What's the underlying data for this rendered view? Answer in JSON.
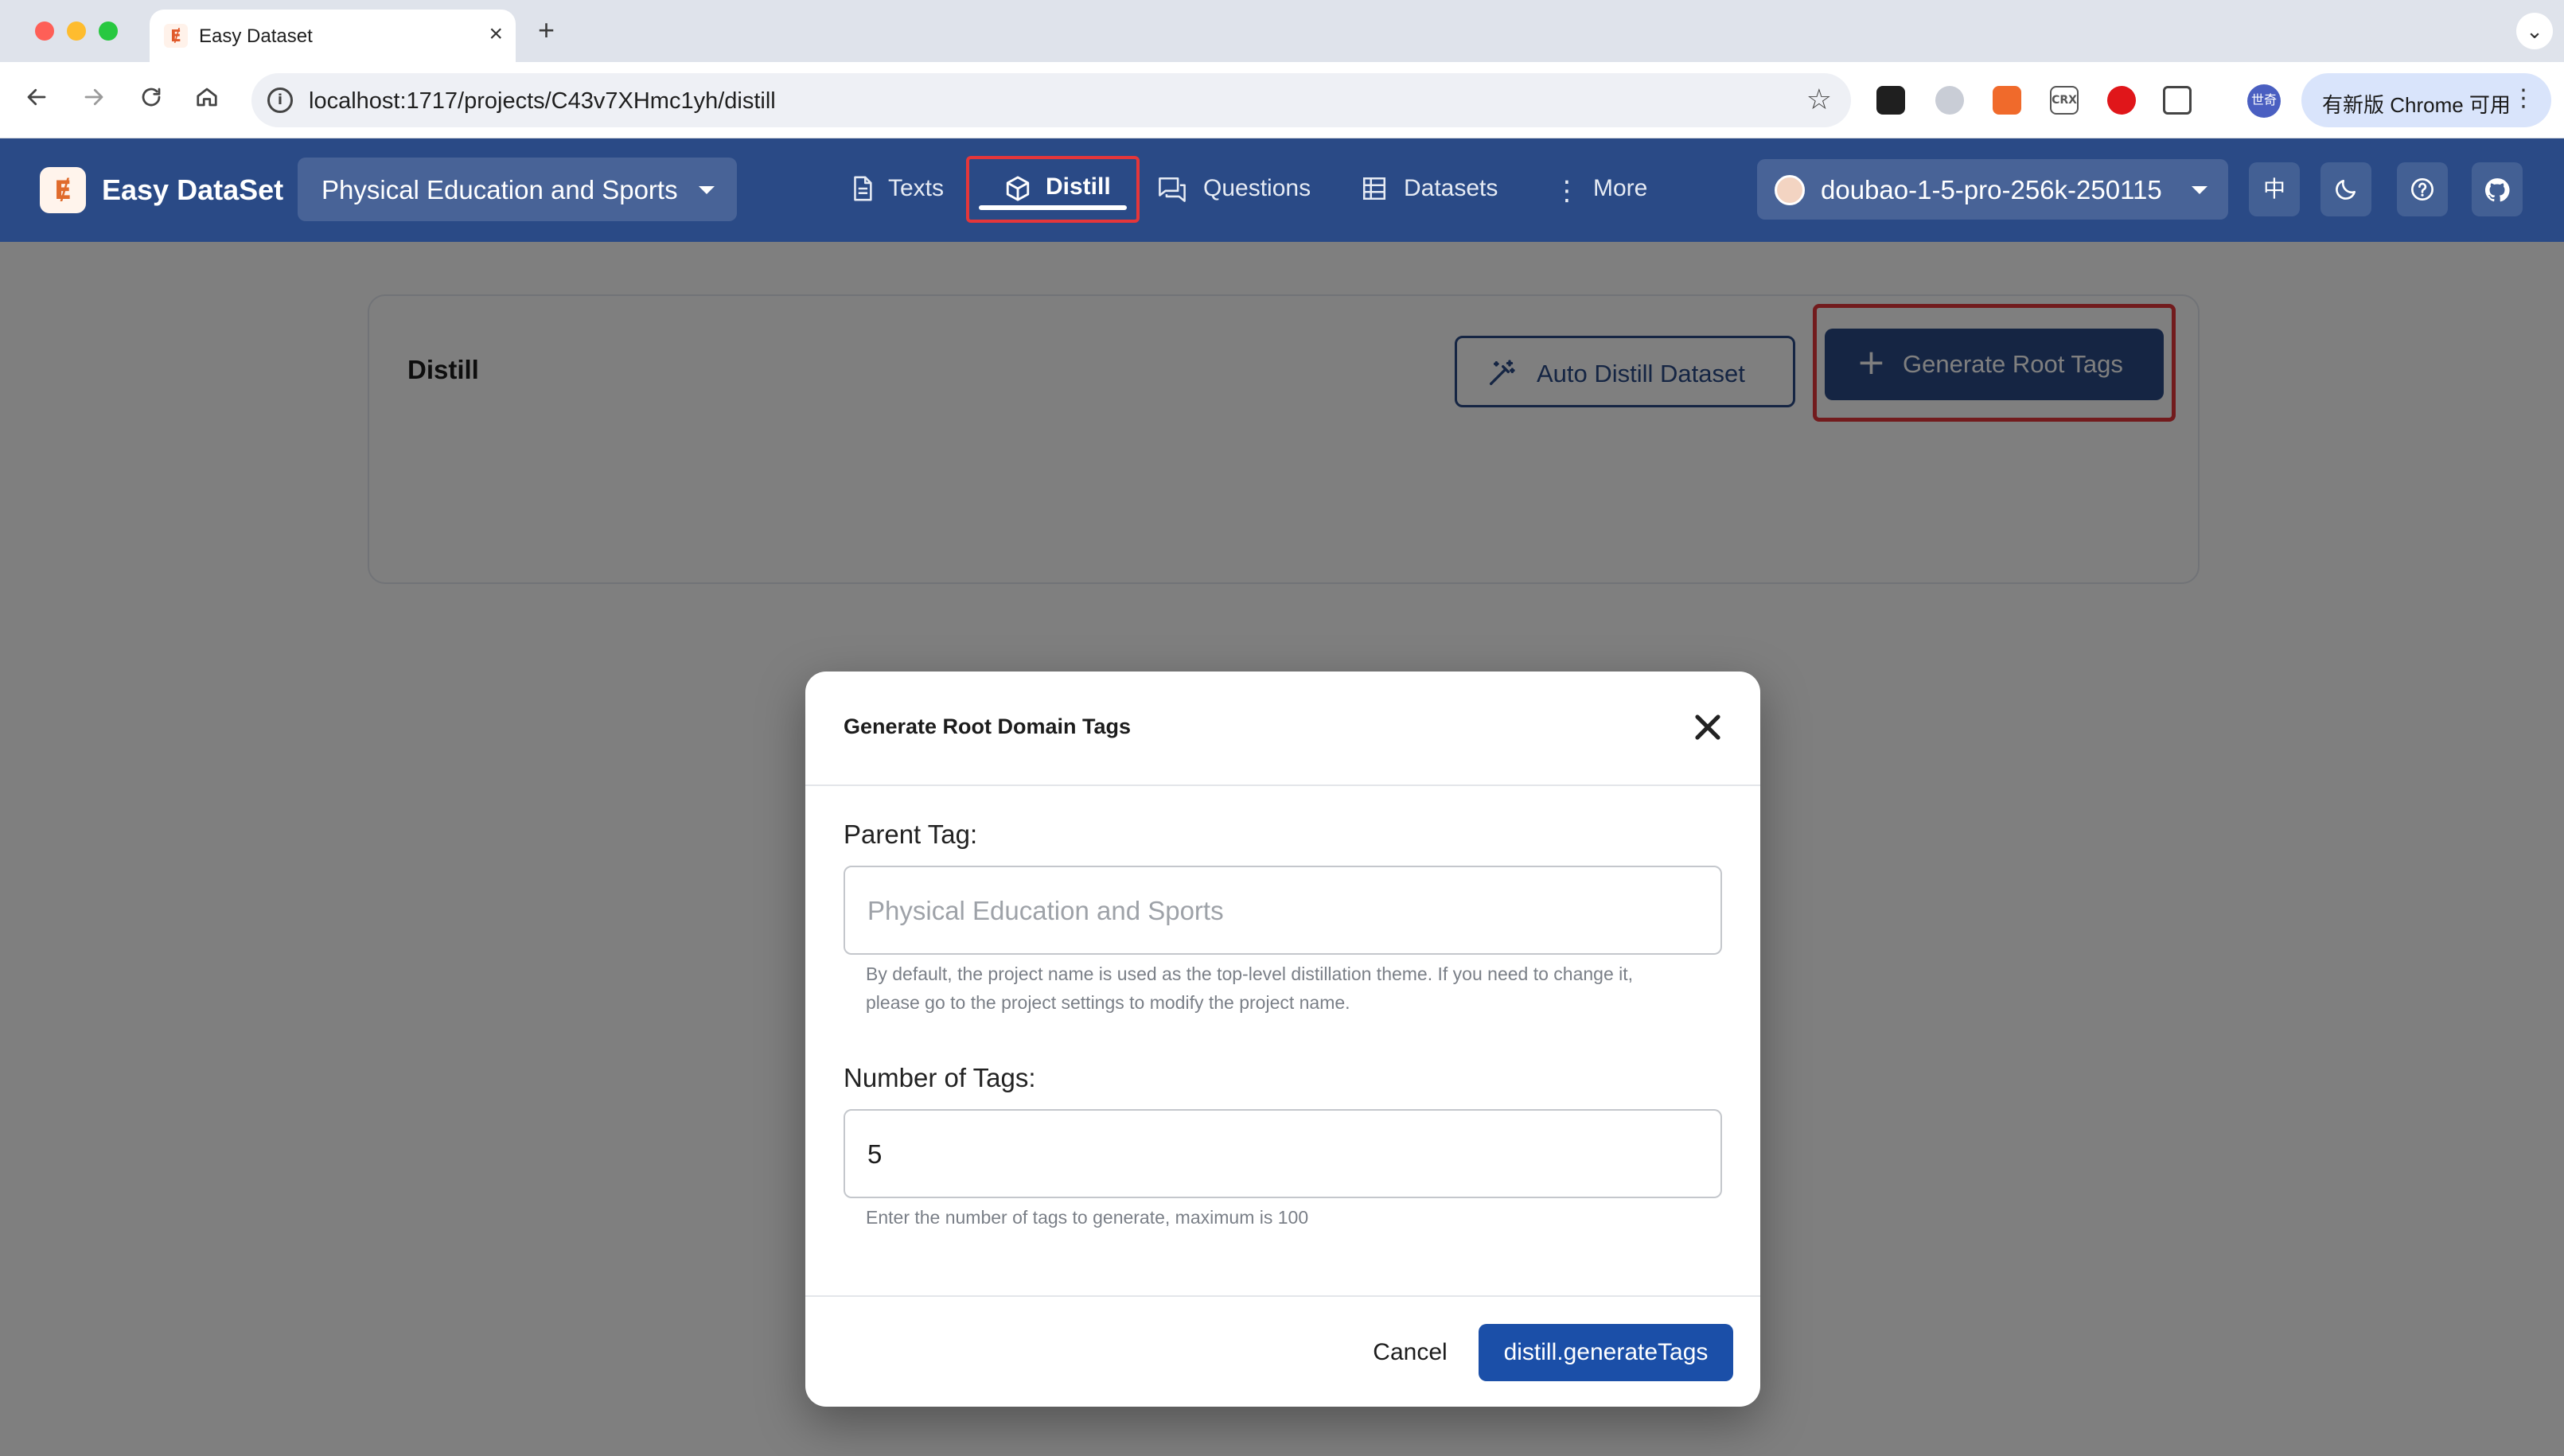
{
  "browser": {
    "tab_title": "Easy Dataset",
    "tab_favicon": "Ɇ",
    "new_tab_label": "+",
    "url": "localhost:1717/projects/C43v7XHmc1yh/distill",
    "profile_label": "世奇",
    "update_label": "有新版 Chrome 可用",
    "extension_crx_label": "CRX",
    "icons": [
      "back-icon",
      "forward-icon",
      "reload-icon",
      "home-icon",
      "site-info-icon",
      "bookmark-star-icon",
      "more-vert-icon"
    ]
  },
  "header": {
    "brand": "Easy DataSet",
    "logo_glyph": "Ɇ",
    "project": "Physical Education and Sports",
    "nav": {
      "texts": "Texts",
      "distill": "Distill",
      "questions": "Questions",
      "datasets": "Datasets",
      "more": "More"
    },
    "model": "doubao-1-5-pro-256k-250115",
    "lang_toggle": "中",
    "colors": {
      "appbar": "#2a4a86",
      "highlight": "#e5363a"
    }
  },
  "main": {
    "card_title": "Distill",
    "auto_distill_button": "Auto Distill Dataset",
    "generate_root_button": "Generate Root Tags",
    "generate_root_icon": "+"
  },
  "dialog": {
    "title": "Generate Root Domain Tags",
    "parent_tag_label": "Parent Tag:",
    "parent_tag_placeholder": "Physical Education and Sports",
    "parent_tag_help": "By default, the project name is used as the top-level distillation theme. If you need to change it, please go to the project settings to modify the project name.",
    "count_label": "Number of Tags:",
    "count_value": "5",
    "count_help": "Enter the number of tags to generate, maximum is 100",
    "cancel_button": "Cancel",
    "submit_button": "distill.generateTags",
    "submit_color": "#1b4fa8"
  }
}
